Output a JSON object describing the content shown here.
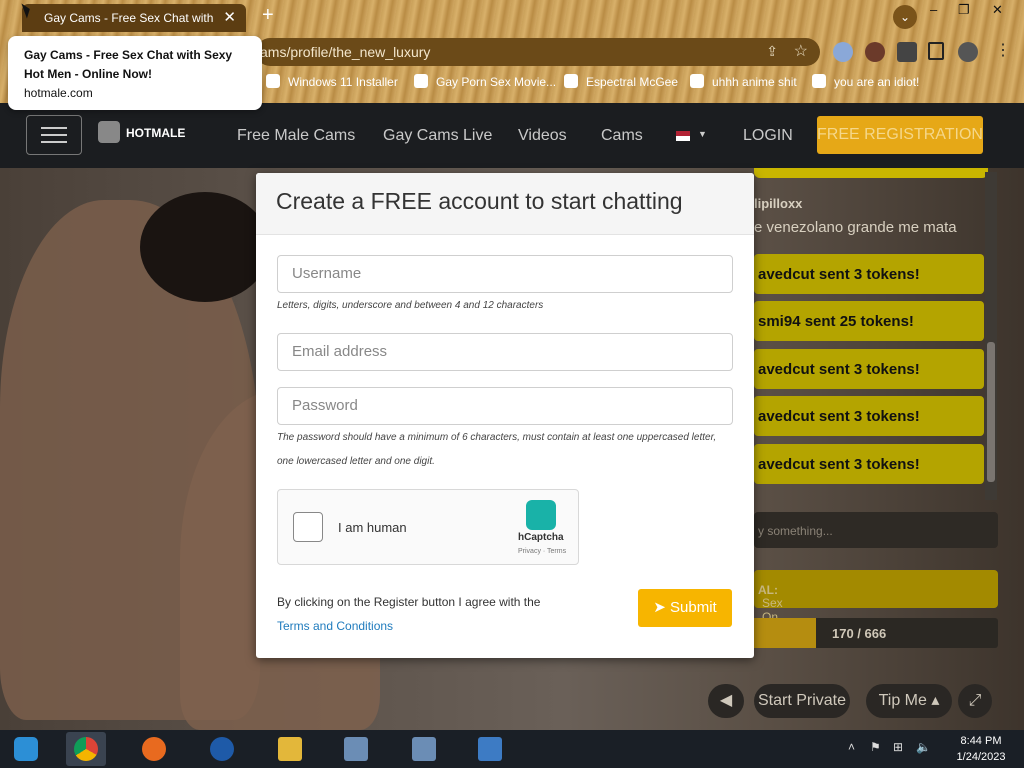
{
  "browser": {
    "tab_title": "Gay Cams - Free Sex Chat with S",
    "url": "ams/profile/the_new_luxury",
    "new_tab_symbol": "+",
    "tab_close_symbol": "✕",
    "window_controls": [
      "–",
      "❐",
      "✕"
    ],
    "bookmarks": [
      {
        "label": "Windows 11 Installer"
      },
      {
        "label": "Gay Porn Sex Movie..."
      },
      {
        "label": "Espectral McGee"
      },
      {
        "label": "uhhh anime shit"
      },
      {
        "label": "you are an idiot!"
      }
    ],
    "tooltip": {
      "title": "Gay Cams - Free Sex Chat with Sexy Hot Men - Online Now!",
      "domain": "hotmale.com"
    }
  },
  "site_nav": {
    "logo_text": "HOTMALE",
    "links": [
      "Free Male Cams",
      "Gay Cams Live",
      "Videos",
      "Cams"
    ],
    "login": "LOGIN",
    "free_registration": "FREE REGISTRATION"
  },
  "chat": {
    "username": "lipilloxx",
    "message": "e venezolano grande me mata",
    "token_messages": [
      "avedcut sent 3 tokens!",
      "smi94 sent 25 tokens!",
      "avedcut sent 3 tokens!",
      "avedcut sent 3 tokens!",
      "avedcut sent 3 tokens!"
    ],
    "input_placeholder": "y something...",
    "goal_prefix": "AL:",
    "goal_text": "Sex On Train",
    "progress_text": "170 / 666",
    "progress_fraction": 0.255
  },
  "video_controls": {
    "start_private": "Start Private",
    "tip_me": "Tip Me"
  },
  "modal": {
    "title": "Create a FREE account to start chatting",
    "username_placeholder": "Username",
    "username_hint": "Letters, digits, underscore and between 4 and 12 characters",
    "email_placeholder": "Email address",
    "password_placeholder": "Password",
    "password_hint": "The password should have a minimum of 6 characters, must contain at least one uppercased letter, one lowercased letter and one digit.",
    "captcha_label": "I am human",
    "captcha_brand": "hCaptcha",
    "captcha_terms": "Privacy · Terms",
    "agree_text": "By clicking on the Register button I agree with the",
    "terms_link": "Terms and Conditions",
    "submit_label": "Submit"
  },
  "taskbar": {
    "time": "8:44 PM",
    "date": "1/24/2023"
  }
}
